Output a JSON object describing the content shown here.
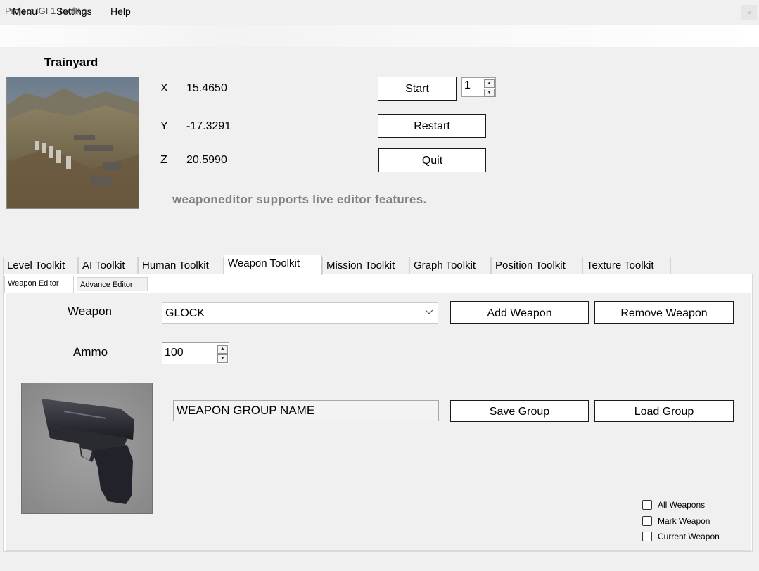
{
  "window": {
    "title": "Project IGI 1 ToolKit",
    "close_glyph": "×"
  },
  "menu": {
    "items": [
      "Menu",
      "Settings",
      "Help"
    ]
  },
  "level": {
    "name": "Trainyard",
    "x_label": "X",
    "x_value": "15.4650",
    "y_label": "Y",
    "y_value": "-17.3291",
    "z_label": "Z",
    "z_value": "20.5990",
    "level_number": "1"
  },
  "buttons": {
    "start": "Start",
    "restart": "Restart",
    "quit": "Quit"
  },
  "info_text": "weaponeditor supports live editor features.",
  "main_tabs": [
    "Level Toolkit",
    "AI Toolkit",
    "Human Toolkit",
    "Weapon Toolkit",
    "Mission Toolkit",
    "Graph Toolkit",
    "Position Toolkit",
    "Texture Toolkit"
  ],
  "active_main_tab": "Weapon Toolkit",
  "sub_tabs": [
    "Weapon Editor",
    "Advance Editor"
  ],
  "weapon_editor": {
    "weapon_label": "Weapon",
    "weapon_value": "GLOCK",
    "ammo_label": "Ammo",
    "ammo_value": "100",
    "add_weapon": "Add Weapon",
    "remove_weapon": "Remove Weapon",
    "group_name": "WEAPON GROUP NAME",
    "save_group": "Save Group",
    "load_group": "Load Group",
    "checkboxes": [
      {
        "label": "All Weapons",
        "checked": false
      },
      {
        "label": "Mark Weapon",
        "checked": false
      },
      {
        "label": "Current Weapon",
        "checked": false
      }
    ]
  },
  "icons": {
    "spin_up": "▲",
    "spin_down": "▼",
    "dropdown": "chevron-down-icon"
  }
}
